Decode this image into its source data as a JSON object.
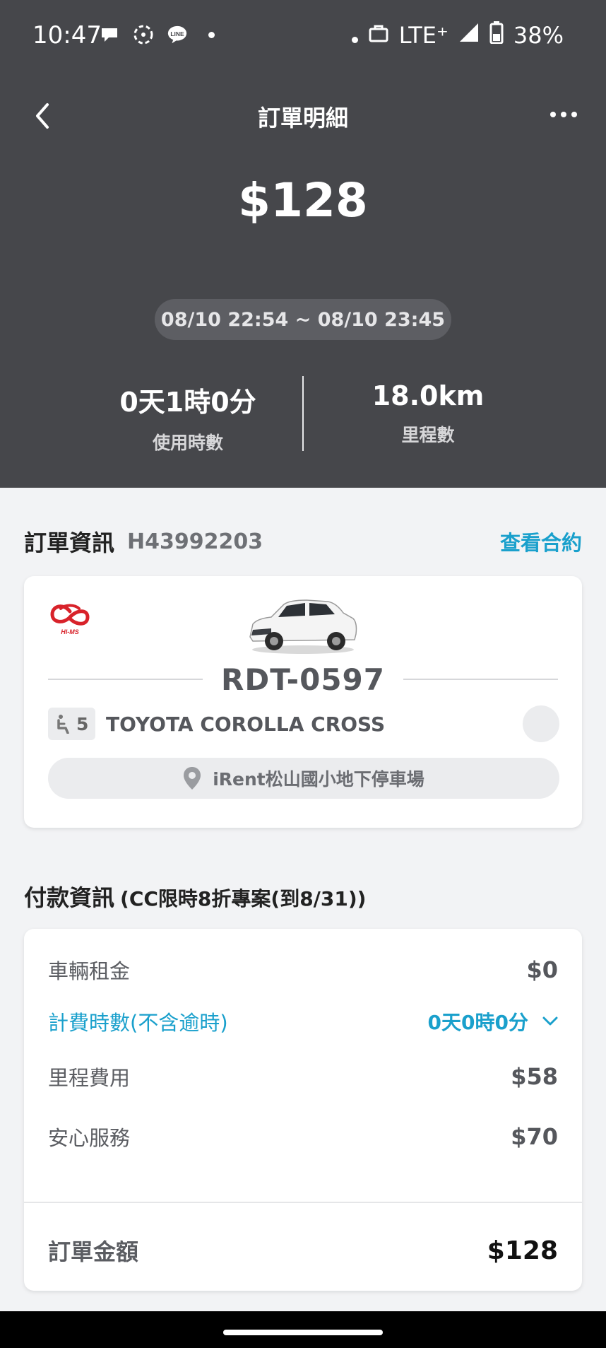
{
  "status_bar": {
    "time": "10:47",
    "network": "LTE⁺",
    "battery": "38%",
    "icons": [
      "chat-bubble-icon",
      "pinwheel-icon",
      "line-icon",
      "dot-icon",
      "dot-icon",
      "briefcase-icon",
      "signal-icon",
      "battery-icon"
    ]
  },
  "nav": {
    "title": "訂單明細",
    "back_icon": "chevron-left-icon",
    "more_icon": "more-horizontal-icon"
  },
  "summary": {
    "total": "$128",
    "period": "08/10 22:54 ~ 08/10 23:45",
    "duration_value": "0天1時0分",
    "duration_label": "使用時數",
    "mileage_value": "18.0km",
    "mileage_label": "里程數"
  },
  "order": {
    "section_title": "訂單資訊",
    "order_number": "H43992203",
    "contract_link": "查看合約",
    "plate": "RDT-0597",
    "seats": "5",
    "model": "TOYOTA COROLLA CROSS",
    "location": "iRent松山國小地下停車場",
    "logo_text": "HI-MS"
  },
  "payment": {
    "section_title": "付款資訊",
    "subtitle": "(CC限時8折專案(到8/31))",
    "rows": [
      {
        "label": "車輛租金",
        "amount": "$0"
      },
      {
        "label": "計費時數(不含逾時)",
        "amount": "0天0時0分"
      },
      {
        "label": "里程費用",
        "amount": "$58"
      },
      {
        "label": "安心服務",
        "amount": "$70"
      }
    ],
    "total_label": "訂單金額",
    "total_amount": "$128"
  },
  "colors": {
    "header_bg": "#46474b",
    "accent": "#1aa0cc",
    "page_bg": "#f2f3f5"
  }
}
